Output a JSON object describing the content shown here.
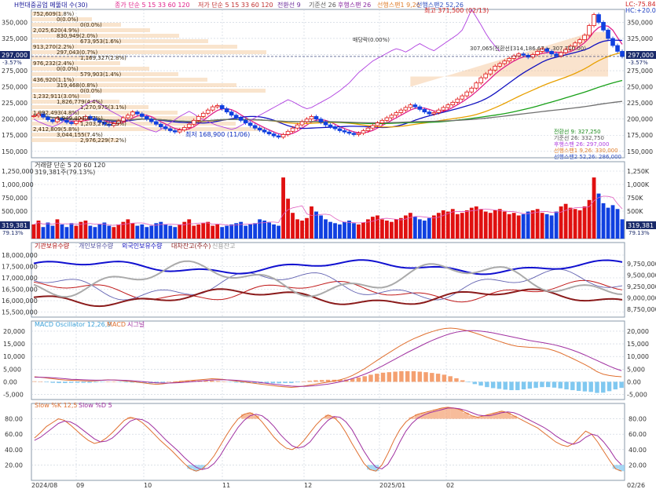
{
  "colors": {
    "up": "#e01010",
    "down": "#1040e0",
    "ma5": "#e0208a",
    "ma15": "#1010c0",
    "ma33": "#e8a000",
    "ma60": "#18a018",
    "ma120": "#707070",
    "ichimoku": "#f0a060",
    "cloud": "#f4c090",
    "panel_border": "#8899aa",
    "grid": "#c8d0dc"
  },
  "price_panel": {
    "legend": [
      "H현대중공업 메뚤대 수(30)",
      "종가 단순 5 15 33 60 120",
      "저가 단순 5 15 33 60 120",
      "전환선 9",
      "기준선 26",
      "후행스팬 26",
      "선행스팬1 9,26",
      "선행스팬2 52,26"
    ],
    "corner_right": [
      "LC:-75.84",
      "HC:+20.05"
    ],
    "y_ticks": [
      "350,000",
      "325,000",
      "300,000",
      "275,000",
      "250,000",
      "225,000",
      "200,000",
      "175,000",
      "150,000"
    ],
    "current_price_tag": "297,000",
    "current_pct_tag": "-3.57%",
    "high_label": "최고 371,500 (02/13)",
    "low_label": "최저 168,900 (11/06)",
    "left_levels": [
      "752,609(1.8%)",
      "0(0.0%)",
      "0(0.0%)",
      "2,025,620(4.9%)",
      "830,949(2.0%)",
      "673,953(1.6%)",
      "913,270(2.2%)",
      "297,043(0.7%)",
      "1,169,327(2.8%)",
      "976,232(2.4%)",
      "0(0.0%)",
      "579,903(1.4%)",
      "436,920(1.1%)",
      "319,468(0.8%)",
      "0(0.0%)",
      "1,232,911(3.0%)",
      "1,826,779(4.4%)",
      "1,270,975(3.1%)",
      "1,992,493(4.8%)",
      "1,949,404(4.7%)",
      "1,203,272(2.9%)",
      "2,412,809(5.8%)",
      "3,044,155(7.4%)",
      "2,976,229(7.2%)"
    ],
    "annotations": [
      "매당락(0.00%)",
      "307,065(전환선)",
      "(314,186.67 ~ 307,710.00)"
    ],
    "bottom_legend": [
      "전환선 9: 327,250",
      "기준선 26: 332,750",
      "후행스팬 26: 297,000",
      "선행스팬1 9,26: 330,000",
      "선행스팬2 52,26: 286,000"
    ]
  },
  "volume_panel": {
    "legend": [
      "거래량 단순 5 20 60 120"
    ],
    "sub": "319,381주(79.13%)",
    "y_ticks": [
      "1,250,000",
      "1,000,000",
      "750,000",
      "500,000",
      "250,000"
    ],
    "right_ticks": [
      "1,250K",
      "1,000K",
      "750K",
      "500K",
      "250K"
    ],
    "value_tag": "319,381",
    "pct_tag": "79.13%"
  },
  "flow_panel": {
    "legend": [
      "기관보유수량",
      "개인보유수량",
      "외국인보유수량",
      "대차잔고(주수)",
      "신용잔고"
    ],
    "y_ticks_left": [
      "18,000,000",
      "17,500,000",
      "17,000,000",
      "16,500,000",
      "16,000,000",
      "15,500,000"
    ],
    "y_ticks_right": [
      "9,750,000",
      "9,500,000",
      "9,250,000",
      "9,000,000",
      "8,750,000"
    ]
  },
  "macd_panel": {
    "legend": [
      "MACD Oscillator 12,26,9",
      "MACD",
      "시그널"
    ],
    "y_ticks": [
      "20,000",
      "15,000",
      "10,000",
      "5,000",
      "0.00",
      "-5,000"
    ]
  },
  "stoch_panel": {
    "legend": [
      "Slow %K 12,5",
      "Slow %D 5"
    ],
    "y_ticks": [
      "80.00",
      "60.00",
      "40.00",
      "20.00"
    ]
  },
  "x_axis": {
    "labels": [
      "2024/08",
      "09",
      "10",
      "11",
      "12",
      "2025/01",
      "02",
      "02/26"
    ]
  },
  "chart_data": {
    "type": "candlestick",
    "series_count_note": "daily candles Aug 2024 - Feb 2025",
    "close": [
      205000,
      208000,
      203000,
      199000,
      196000,
      201000,
      198000,
      195000,
      193000,
      197000,
      200000,
      204000,
      201000,
      198000,
      195000,
      192000,
      190000,
      193000,
      197000,
      202000,
      206000,
      211000,
      208000,
      204000,
      200000,
      196000,
      192000,
      188000,
      185000,
      182000,
      180000,
      183000,
      187000,
      192000,
      198000,
      204000,
      209000,
      214000,
      219000,
      221000,
      216000,
      211000,
      206000,
      202000,
      198000,
      194000,
      190000,
      186000,
      183000,
      180000,
      177000,
      174000,
      172000,
      176000,
      181000,
      186000,
      191000,
      196000,
      200000,
      204000,
      200000,
      195000,
      191000,
      188000,
      185000,
      182000,
      180000,
      178000,
      176000,
      178000,
      182000,
      186000,
      190000,
      194000,
      198000,
      202000,
      206000,
      210000,
      214000,
      218000,
      222000,
      219000,
      215000,
      211000,
      208000,
      210000,
      214000,
      218000,
      222000,
      226000,
      231000,
      236000,
      242000,
      248000,
      256000,
      264000,
      270000,
      276000,
      282000,
      286000,
      290000,
      294000,
      298000,
      301000,
      299000,
      296000,
      300000,
      305000,
      309000,
      305000,
      301000,
      298000,
      303000,
      308000,
      313000,
      318000,
      323000,
      330000,
      345000,
      362000,
      350000,
      338000,
      325000,
      314000,
      305000,
      297000
    ],
    "volume_pct": [
      0.22,
      0.28,
      0.18,
      0.25,
      0.2,
      0.3,
      0.22,
      0.18,
      0.24,
      0.2,
      0.26,
      0.28,
      0.2,
      0.18,
      0.22,
      0.25,
      0.2,
      0.18,
      0.22,
      0.26,
      0.3,
      0.24,
      0.2,
      0.22,
      0.18,
      0.2,
      0.24,
      0.26,
      0.22,
      0.2,
      0.18,
      0.22,
      0.26,
      0.3,
      0.2,
      0.22,
      0.24,
      0.26,
      0.2,
      0.22,
      0.18,
      0.2,
      0.22,
      0.24,
      0.26,
      0.2,
      0.22,
      0.24,
      0.3,
      0.28,
      0.25,
      0.22,
      0.2,
      0.95,
      0.62,
      0.4,
      0.3,
      0.28,
      0.32,
      0.5,
      0.42,
      0.36,
      0.3,
      0.26,
      0.24,
      0.22,
      0.26,
      0.28,
      0.24,
      0.22,
      0.25,
      0.3,
      0.34,
      0.36,
      0.3,
      0.28,
      0.26,
      0.3,
      0.32,
      0.36,
      0.4,
      0.34,
      0.3,
      0.28,
      0.32,
      0.36,
      0.4,
      0.44,
      0.42,
      0.46,
      0.38,
      0.4,
      0.44,
      0.48,
      0.5,
      0.46,
      0.42,
      0.4,
      0.44,
      0.46,
      0.42,
      0.38,
      0.4,
      0.36,
      0.38,
      0.42,
      0.44,
      0.46,
      0.4,
      0.38,
      0.36,
      0.42,
      0.5,
      0.54,
      0.48,
      0.46,
      0.44,
      0.5,
      0.6,
      0.95,
      0.7,
      0.55,
      0.48,
      0.52,
      0.46,
      0.3
    ],
    "macd": [
      2000,
      1800,
      1500,
      1200,
      900,
      700,
      600,
      500,
      400,
      300,
      400,
      600,
      800,
      700,
      500,
      300,
      100,
      -200,
      -500,
      -800,
      -1000,
      -800,
      -500,
      -200,
      100,
      400,
      600,
      800,
      1000,
      1200,
      1100,
      900,
      600,
      300,
      0,
      -300,
      -600,
      -900,
      -1200,
      -1500,
      -1800,
      -2000,
      -2200,
      -2000,
      -1700,
      -1300,
      -900,
      -500,
      -100,
      300,
      800,
      1500,
      2500,
      3800,
      5200,
      6800,
      8400,
      10000,
      11500,
      13000,
      14500,
      15800,
      17000,
      18000,
      19000,
      19800,
      20500,
      21000,
      21200,
      21000,
      20600,
      20000,
      19300,
      18500,
      17600,
      16800,
      16000,
      15200,
      14500,
      14000,
      13800,
      13600,
      13500,
      13400,
      13000,
      12300,
      11400,
      10300,
      9200,
      8000,
      6800,
      5500,
      4000,
      3000,
      2500,
      2200,
      2000
    ],
    "signal": [
      1800,
      1800,
      1700,
      1600,
      1400,
      1200,
      1000,
      900,
      800,
      700,
      650,
      650,
      700,
      700,
      650,
      550,
      400,
      200,
      0,
      -200,
      -400,
      -500,
      -500,
      -400,
      -300,
      -100,
      100,
      300,
      500,
      700,
      800,
      800,
      700,
      600,
      400,
      200,
      0,
      -300,
      -600,
      -900,
      -1200,
      -1500,
      -1700,
      -1800,
      -1800,
      -1700,
      -1500,
      -1200,
      -900,
      -500,
      0,
      600,
      1300,
      2100,
      3000,
      4000,
      5200,
      6400,
      7700,
      9000,
      10300,
      11600,
      12800,
      14000,
      15200,
      16300,
      17300,
      18200,
      19000,
      19600,
      20000,
      20200,
      20200,
      20000,
      19700,
      19300,
      18800,
      18300,
      17800,
      17300,
      16800,
      16300,
      15900,
      15500,
      15100,
      14600,
      14000,
      13300,
      12500,
      11600,
      10600,
      9500,
      8400,
      7300,
      6200,
      5200,
      4400
    ],
    "stoch_k": [
      55,
      62,
      70,
      75,
      80,
      78,
      72,
      65,
      58,
      52,
      48,
      50,
      55,
      62,
      70,
      78,
      82,
      80,
      75,
      68,
      60,
      52,
      45,
      38,
      30,
      22,
      15,
      12,
      15,
      22,
      32,
      45,
      58,
      70,
      80,
      86,
      88,
      84,
      76,
      66,
      56,
      48,
      42,
      40,
      44,
      52,
      62,
      72,
      80,
      85,
      82,
      74,
      62,
      48,
      35,
      22,
      14,
      12,
      20,
      35,
      52,
      66,
      76,
      82,
      86,
      88,
      90,
      92,
      94,
      95,
      94,
      92,
      88,
      84,
      82,
      84,
      86,
      88,
      90,
      88,
      84,
      80,
      76,
      72,
      68,
      62,
      56,
      50,
      46,
      44,
      48,
      56,
      64,
      60,
      50,
      38,
      26,
      15,
      12
    ],
    "stoch_d": [
      52,
      56,
      62,
      68,
      74,
      77,
      76,
      72,
      66,
      60,
      54,
      50,
      51,
      55,
      62,
      70,
      77,
      80,
      79,
      75,
      68,
      60,
      52,
      45,
      38,
      30,
      23,
      17,
      14,
      16,
      22,
      32,
      45,
      57,
      69,
      78,
      84,
      86,
      84,
      78,
      70,
      60,
      52,
      45,
      42,
      44,
      50,
      60,
      70,
      78,
      83,
      82,
      76,
      66,
      52,
      38,
      26,
      17,
      15,
      21,
      34,
      50,
      64,
      74,
      81,
      85,
      88,
      90,
      92,
      94,
      94,
      93,
      91,
      88,
      85,
      84,
      84,
      86,
      88,
      89,
      88,
      85,
      81,
      77,
      73,
      69,
      64,
      58,
      53,
      49,
      47,
      50,
      56,
      60,
      58,
      50,
      40,
      28,
      20
    ]
  }
}
